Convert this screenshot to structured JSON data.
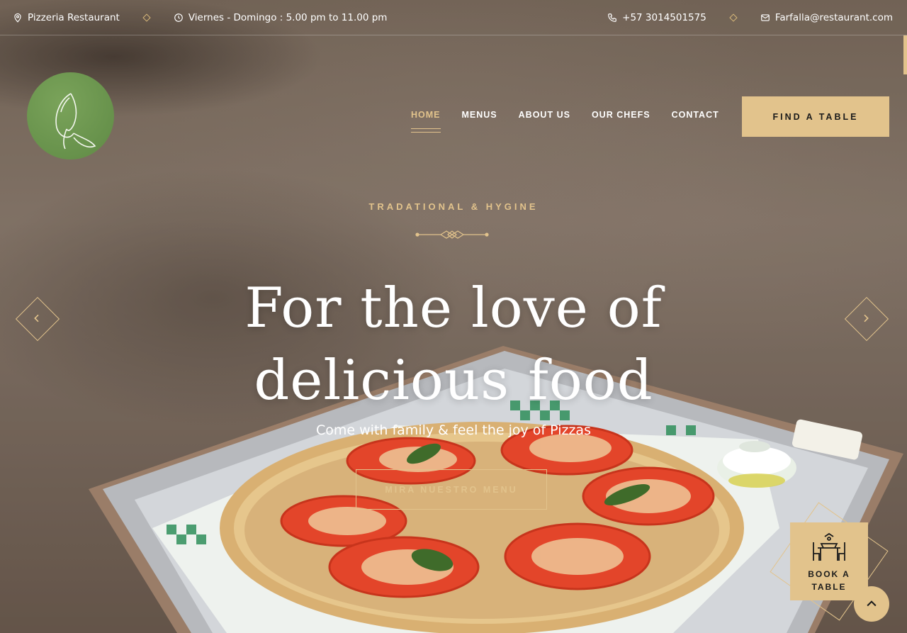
{
  "topbar": {
    "location": "Pizzeria Restaurant",
    "hours": "Viernes - Domingo : 5.00 pm to 11.00 pm",
    "phone": "+57 3014501575",
    "email": "Farfalla@restaurant.com"
  },
  "nav": {
    "items": [
      "HOME",
      "MENUS",
      "ABOUT US",
      "OUR CHEFS",
      "CONTACT"
    ],
    "active": "HOME"
  },
  "header": {
    "cta_label": "FIND A TABLE"
  },
  "hero": {
    "subtitle": "TRADATIONAL & HYGINE",
    "headline_line1": "For the love of",
    "headline_line2": "delicious food",
    "tagline": "Come with family & feel the joy of Pizzas",
    "button_label": "MIRA NUESTRO MENU"
  },
  "widget": {
    "book_label": "BOOK A TABLE"
  },
  "icons": {
    "location": "map-pin-icon",
    "hours": "clock-icon",
    "phone": "phone-icon",
    "email": "envelope-icon",
    "logo": "butterfly-logo",
    "prev": "chevron-left-icon",
    "next": "chevron-right-icon",
    "book": "dining-table-icon",
    "to_top": "chevron-up-icon"
  },
  "colors": {
    "accent": "#e2c38c",
    "logo_green": "#6a9650",
    "text": "#ffffff"
  }
}
